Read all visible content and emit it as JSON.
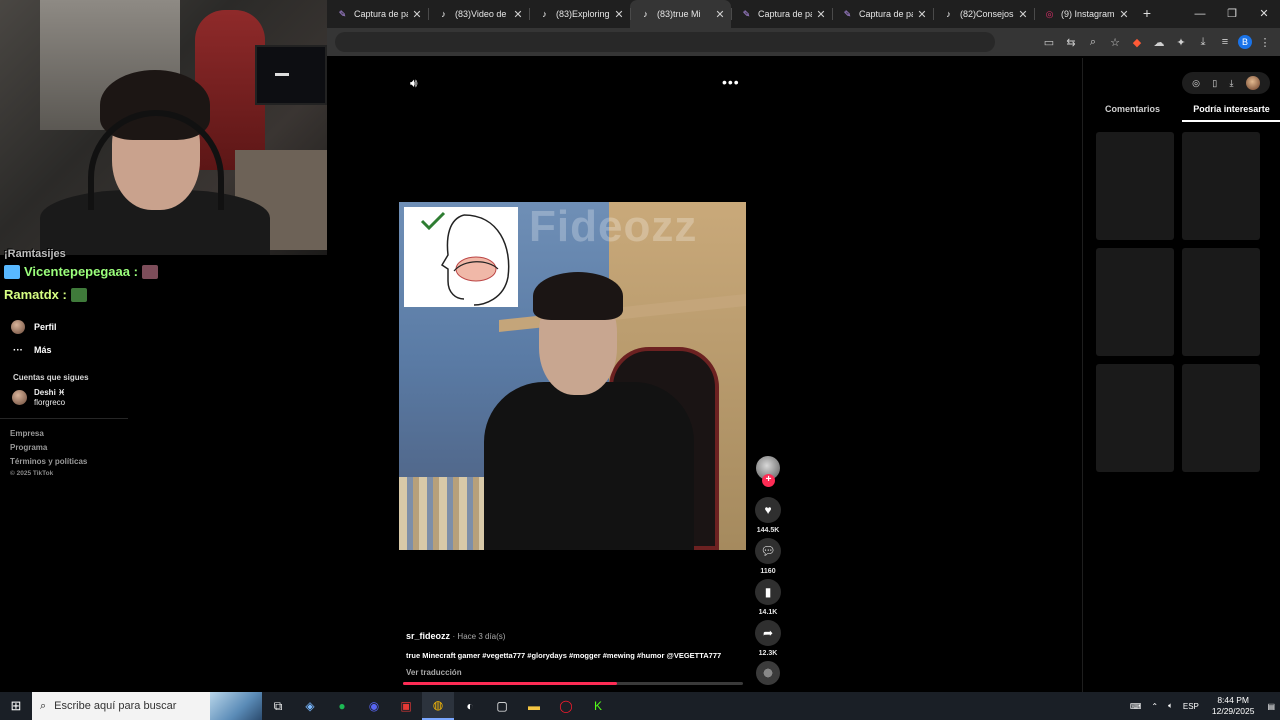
{
  "browser": {
    "tabs": [
      {
        "label": "Captura de pan",
        "icon": "pen-icon",
        "color": "#c39bff"
      },
      {
        "label": "(83)Video de Ju",
        "icon": "tiktok-icon",
        "color": "#ffffff"
      },
      {
        "label": "(83)Exploring t",
        "icon": "tiktok-icon",
        "color": "#ffffff"
      },
      {
        "label": "(83)true Mi",
        "icon": "tiktok-icon",
        "color": "#ffffff",
        "active": true
      },
      {
        "label": "Captura de pan",
        "icon": "pen-icon",
        "color": "#c39bff"
      },
      {
        "label": "Captura de pan",
        "icon": "pen-icon",
        "color": "#c39bff"
      },
      {
        "label": "(82)Consejos d",
        "icon": "tiktok-icon",
        "color": "#ffffff"
      },
      {
        "label": "(9) Instagram",
        "icon": "instagram-icon",
        "color": "#e1306c"
      }
    ],
    "new_tab": "+",
    "profile_letter": "B"
  },
  "chat": {
    "partial": "¡Ramtasijes",
    "messages": [
      {
        "user": "Vicentepepegaaa :",
        "color": "#9bff7c"
      },
      {
        "user": "Ramatdx :",
        "color": "#d7ff83"
      }
    ]
  },
  "sidebar": {
    "profile": "Perfil",
    "more": "Más",
    "following_title": "Cuentas que sigues",
    "following": [
      {
        "name": "Deshi ♓︎",
        "handle": "florgreco"
      }
    ],
    "footer_links": [
      "Empresa",
      "Programa",
      "Términos y políticas"
    ],
    "copyright": "© 2025 TikTok"
  },
  "video": {
    "watermark": "Fideozz",
    "username": "sr_fideozz",
    "time": "· Hace 3 día(s)",
    "description": "true Minecraft gamer #vegetta777 #glorydays #mogger #mewing #humor  @VEGETTA777",
    "translate": "Ver traducción",
    "progress": 0.63
  },
  "actions": {
    "likes": "144.5K",
    "comments": "1160",
    "saves": "14.1K",
    "shares": "12.3K",
    "follow_plus": "+"
  },
  "right_panel": {
    "tabs": [
      "Comentarios",
      "Podría interesarte"
    ],
    "active_tab": 1,
    "tiles": 6
  },
  "taskbar": {
    "search_placeholder": "Escribe aquí para buscar",
    "language": "ESP",
    "time": "8:44 PM",
    "date": "12/29/2025"
  }
}
